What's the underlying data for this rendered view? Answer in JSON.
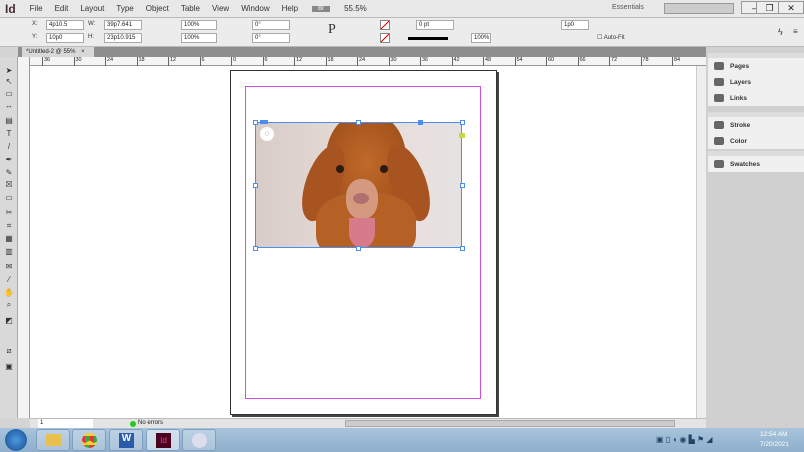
{
  "app": {
    "logo": "Id",
    "zoom": "55.5%",
    "workspace": "Essentials",
    "search_placeholder": ""
  },
  "menu": [
    "File",
    "Edit",
    "Layout",
    "Type",
    "Object",
    "Table",
    "View",
    "Window",
    "Help"
  ],
  "control": {
    "x_label": "X:",
    "x": "4p10.5",
    "y_label": "Y:",
    "y": "10p0",
    "w_label": "W:",
    "w": "39p7.641",
    "h_label": "H:",
    "h": "23p10.915",
    "scale_x": "100%",
    "scale_y": "100%",
    "rotate": "0°",
    "shear": "0°",
    "stroke_weight": "0 pt",
    "opacity": "100%",
    "gap": "1p0",
    "autofit": "Auto-Fit"
  },
  "tab": {
    "title": "*Untitled-2 @ 55%",
    "close": "×"
  },
  "ruler": [
    "36",
    "30",
    "24",
    "18",
    "12",
    "6",
    "0",
    "6",
    "12",
    "18",
    "24",
    "30",
    "36",
    "42",
    "48",
    "54",
    "60",
    "66",
    "72",
    "78",
    "84"
  ],
  "panels": [
    [
      "Pages",
      "Layers",
      "Links"
    ],
    [
      "Stroke",
      "Color"
    ],
    [
      "Swatches"
    ]
  ],
  "status": {
    "page": "1",
    "preflight": "No errors"
  },
  "taskbar": {
    "time": "12:54 AM",
    "date": "7/20/2021",
    "apps": [
      "start",
      "explorer",
      "chrome",
      "word",
      "indesign",
      "paint"
    ]
  },
  "colors": {
    "guide": "#d050e0",
    "frame": "#4a8ff0",
    "indesign": "#49021f"
  }
}
